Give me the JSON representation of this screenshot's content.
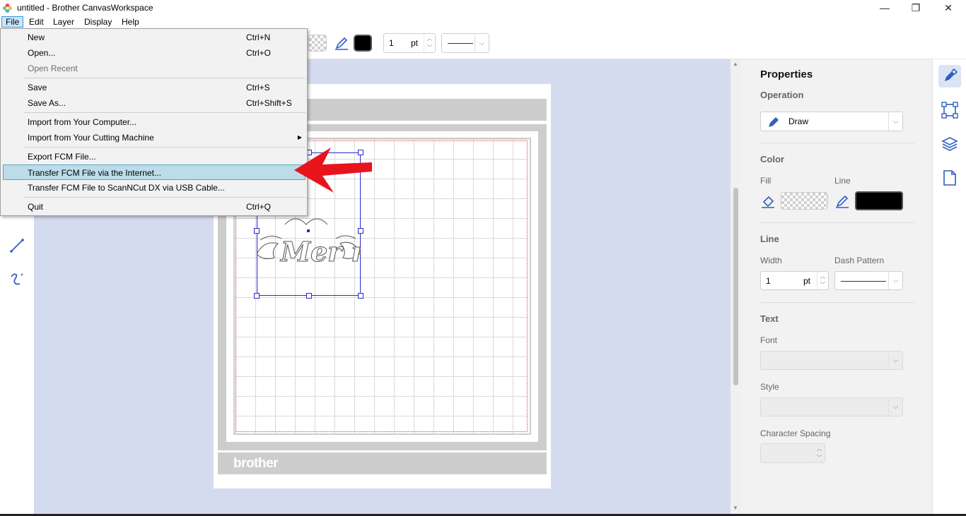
{
  "window": {
    "title": "untitled - Brother CanvasWorkspace",
    "minimize_glyph": "—",
    "maximize_glyph": "❐",
    "close_glyph": "✕"
  },
  "menubar": {
    "items": [
      "File",
      "Edit",
      "Layer",
      "Display",
      "Help"
    ],
    "active": "File"
  },
  "file_menu": {
    "items": [
      {
        "label": "New",
        "shortcut": "Ctrl+N",
        "disabled": false
      },
      {
        "label": "Open...",
        "shortcut": "Ctrl+O",
        "disabled": false
      },
      {
        "label": "Open Recent",
        "shortcut": "",
        "disabled": true
      },
      {
        "label": "Save",
        "shortcut": "Ctrl+S",
        "disabled": false
      },
      {
        "label": "Save As...",
        "shortcut": "Ctrl+Shift+S",
        "disabled": false
      },
      {
        "label": "Import from Your Computer...",
        "shortcut": "",
        "disabled": false
      },
      {
        "label": "Import from Your Cutting Machine",
        "shortcut": "",
        "disabled": false,
        "submenu": true
      },
      {
        "label": "Export FCM File...",
        "shortcut": "",
        "disabled": false
      },
      {
        "label": "Transfer FCM File via the Internet...",
        "shortcut": "",
        "disabled": false,
        "highlighted": true
      },
      {
        "label": "Transfer FCM File to ScanNCut DX via USB Cable...",
        "shortcut": "",
        "disabled": false
      },
      {
        "label": "Quit",
        "shortcut": "Ctrl+Q",
        "disabled": false
      }
    ],
    "submenu_arrow": "▶"
  },
  "toolbar": {
    "line_width_value": "1",
    "line_width_unit": "pt"
  },
  "canvas": {
    "brand_text": "brother",
    "design_text": "Mer mama"
  },
  "properties": {
    "title": "Properties",
    "operation_label": "Operation",
    "operation_value": "Draw",
    "color_label": "Color",
    "fill_label": "Fill",
    "line_label": "Line",
    "line_section_label": "Line",
    "width_label": "Width",
    "width_value": "1",
    "width_unit": "pt",
    "dash_pattern_label": "Dash Pattern",
    "text_section_label": "Text",
    "font_label": "Font",
    "style_label": "Style",
    "char_spacing_label": "Character Spacing",
    "line_color": "#000000"
  },
  "icons": {
    "chevron_down": "⌵",
    "spin_up": "︿",
    "spin_down": "﹀"
  }
}
